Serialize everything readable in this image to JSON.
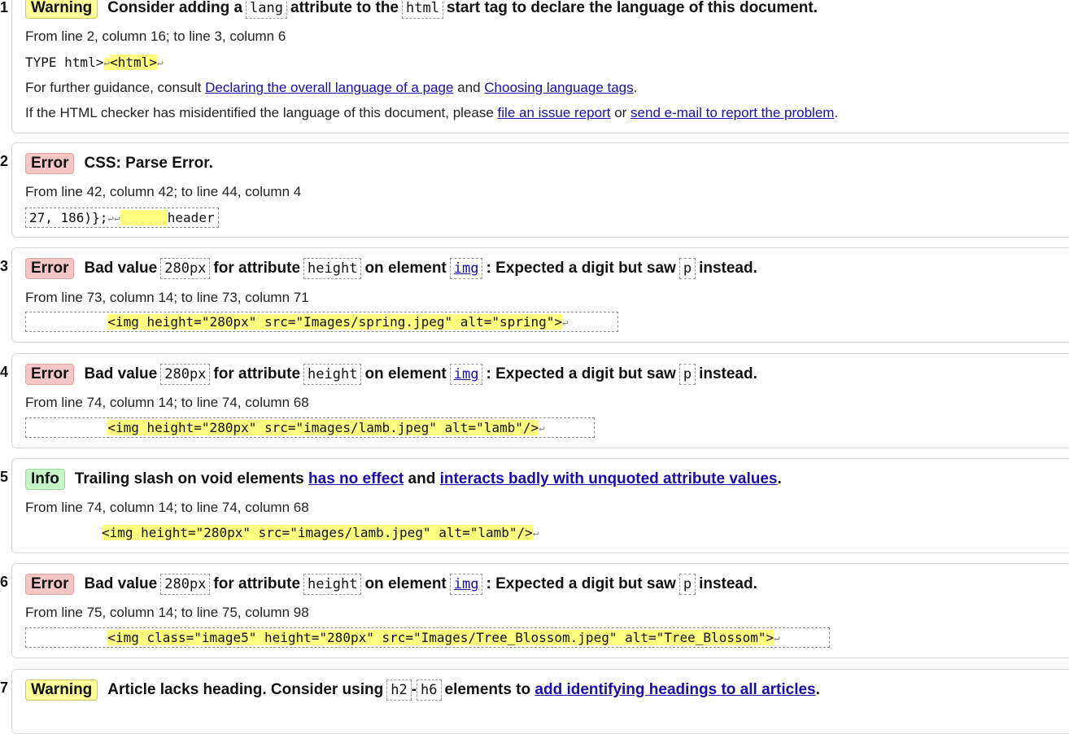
{
  "messages": [
    {
      "num": "1.",
      "type_label": "Warning",
      "h1": "Consider adding a",
      "c1": "lang",
      "h2": "attribute to the",
      "c2": "html",
      "h3": "start tag to declare the language of this document.",
      "location": "From line 2, column 16; to line 3, column 6",
      "extract_pre": "TYPE html>",
      "extract_hl": "<html>",
      "guidance_pre": "For further guidance, consult",
      "guidance_link1": "Declaring the overall language of a page",
      "guidance_mid": "and",
      "guidance_link2": "Choosing language tags",
      "guidance_post": ".",
      "misid_pre": "If the HTML checker has misidentified the language of this document, please",
      "misid_link1": "file an issue report",
      "misid_mid": "or",
      "misid_link2": "send e-mail to report the problem",
      "misid_post": "."
    },
    {
      "num": "2.",
      "type_label": "Error",
      "title": "CSS: Parse Error.",
      "location": "From line 42, column 42; to line 44, column 4",
      "extract_pre": "27, 186)};",
      "extract_hl": "      ",
      "extract_post": "header"
    },
    {
      "num": "3.",
      "type_label": "Error",
      "h1": "Bad value",
      "c1": "280px",
      "h2": "for attribute",
      "c2": "height",
      "h3": "on element",
      "c3": "img",
      "h4": ": Expected a digit but saw",
      "c4": "p",
      "h5": "instead.",
      "location": "From line 73, column 14; to line 73, column 71",
      "extract_pre": "          ",
      "extract_hl": "<img height=\"280px\" src=\"Images/spring.jpeg\" alt=\"spring\">"
    },
    {
      "num": "4.",
      "type_label": "Error",
      "h1": "Bad value",
      "c1": "280px",
      "h2": "for attribute",
      "c2": "height",
      "h3": "on element",
      "c3": "img",
      "h4": ": Expected a digit but saw",
      "c4": "p",
      "h5": "instead.",
      "location": "From line 74, column 14; to line 74, column 68",
      "extract_pre": "          ",
      "extract_hl": "<img height=\"280px\" src=\"images/lamb.jpeg\" alt=\"lamb\"/>"
    },
    {
      "num": "5.",
      "type_label": "Info",
      "h1": "Trailing slash on void elements",
      "link1": "has no effect",
      "h2": "and",
      "link2": "interacts badly with unquoted attribute values",
      "h3": ".",
      "location": "From line 74, column 14; to line 74, column 68",
      "extract_hl": "<img height=\"280px\" src=\"images/lamb.jpeg\" alt=\"lamb\"/>"
    },
    {
      "num": "6.",
      "type_label": "Error",
      "h1": "Bad value",
      "c1": "280px",
      "h2": "for attribute",
      "c2": "height",
      "h3": "on element",
      "c3": "img",
      "h4": ": Expected a digit but saw",
      "c4": "p",
      "h5": "instead.",
      "location": "From line 75, column 14; to line 75, column 98",
      "extract_pre": "          ",
      "extract_hl": "<img class=\"image5\" height=\"280px\" src=\"Images/Tree_Blossom.jpeg\" alt=\"Tree_Blossom\">"
    },
    {
      "num": "7.",
      "type_label": "Warning",
      "h1": "Article lacks heading. Consider using",
      "c1": "h2",
      "dash": "-",
      "c2": "h6",
      "h2": "elements to",
      "link1": "add identifying headings to all articles",
      "h3": "."
    }
  ],
  "lf_glyph": "↩",
  "colors": {
    "warning": "#ffff99",
    "error": "#f5c6c6",
    "info": "#c6f5c6",
    "highlight": "#ffff80",
    "link": "#1a0dab"
  }
}
